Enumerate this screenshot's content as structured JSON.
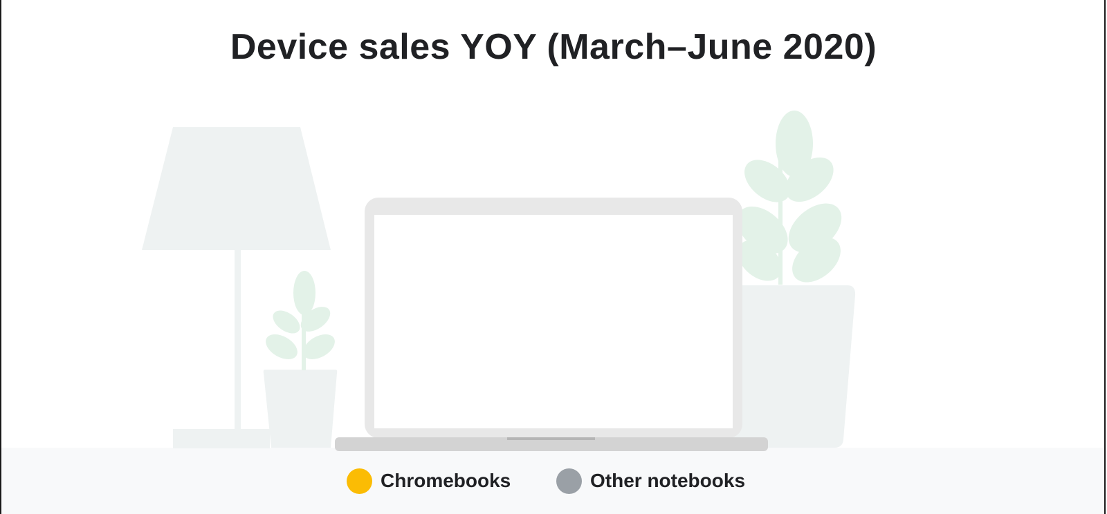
{
  "chart_data": {
    "type": "bar",
    "title": "Device sales YOY (March–June 2020)",
    "series": [
      {
        "name": "Chromebooks",
        "color": "#fbbc04"
      },
      {
        "name": "Other notebooks",
        "color": "#9aa0a6"
      }
    ]
  },
  "legend": {
    "items": [
      {
        "label": "Chromebooks",
        "color": "#fbbc04"
      },
      {
        "label": "Other notebooks",
        "color": "#9aa0a6"
      }
    ]
  },
  "scene": {
    "icons": [
      "lamp-icon",
      "small-plant-icon",
      "laptop-icon",
      "large-plant-icon"
    ]
  }
}
